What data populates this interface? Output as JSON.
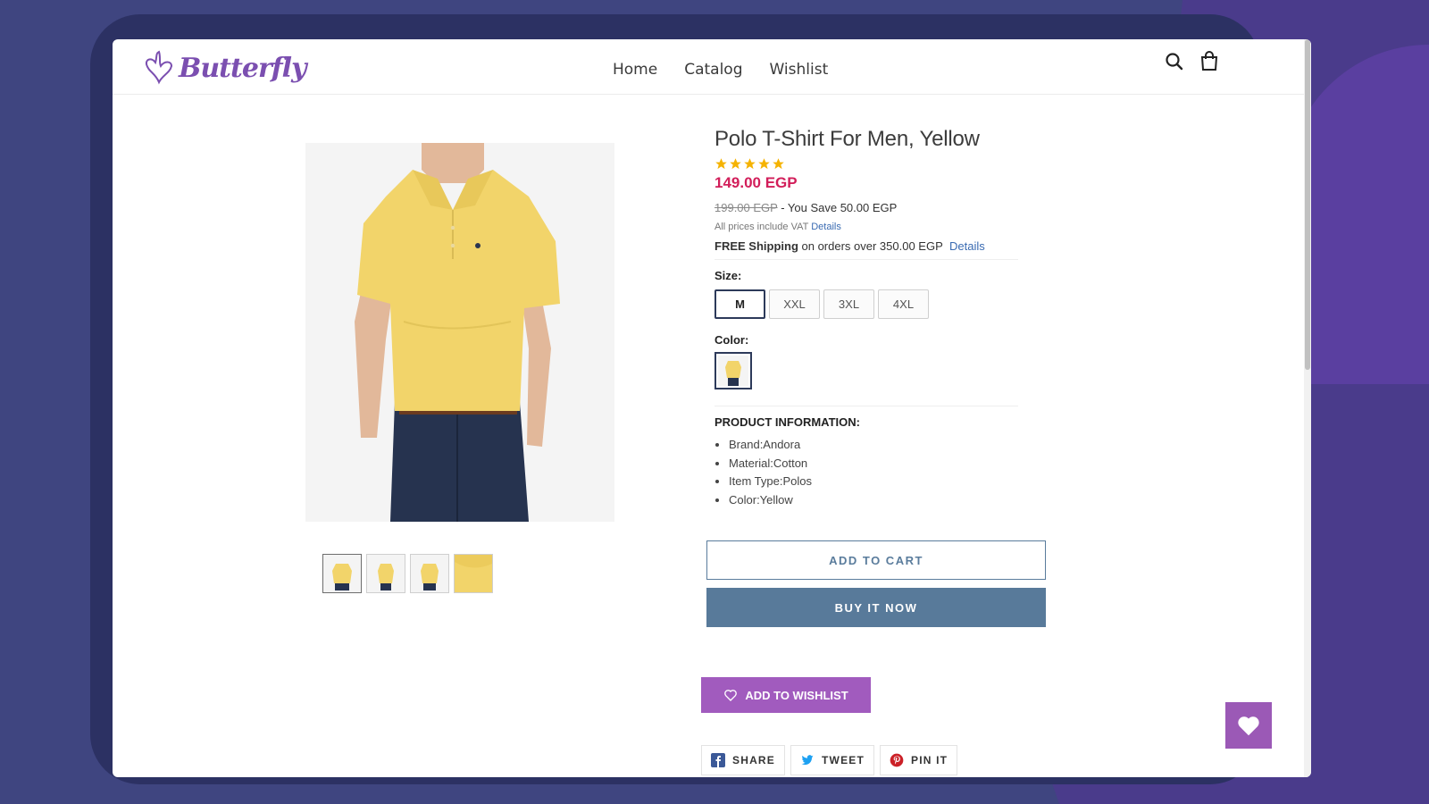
{
  "brand": {
    "name": "Butterfly"
  },
  "nav": {
    "items": [
      "Home",
      "Catalog",
      "Wishlist"
    ]
  },
  "product": {
    "title": "Polo T-Shirt For Men, Yellow",
    "rating": 5,
    "price": "149.00 EGP",
    "old_price": "199.00 EGP",
    "you_save": " - You Save 50.00 EGP",
    "vat_text": "All prices include VAT",
    "vat_link": "Details",
    "shipping_bold": "FREE Shipping",
    "shipping_text": " on orders over 350.00 EGP",
    "shipping_link": "Details",
    "size_label": "Size:",
    "sizes": [
      "M",
      "XXL",
      "3XL",
      "4XL"
    ],
    "selected_size": "M",
    "color_label": "Color:",
    "info_title": "PRODUCT INFORMATION:",
    "info_items": [
      "Brand:Andora",
      "Material:Cotton",
      "Item Type:Polos",
      "Color:Yellow"
    ]
  },
  "actions": {
    "add_to_cart": "ADD TO CART",
    "buy_now": "BUY IT NOW",
    "add_to_wishlist": "ADD TO WISHLIST"
  },
  "share": {
    "facebook": "SHARE",
    "twitter": "TWEET",
    "pinterest": "PIN IT"
  },
  "colors": {
    "accent_purple": "#a15bbe",
    "price_red": "#d21e5a",
    "button_blue": "#587a9a",
    "shirt_yellow": "#f2d46a"
  }
}
